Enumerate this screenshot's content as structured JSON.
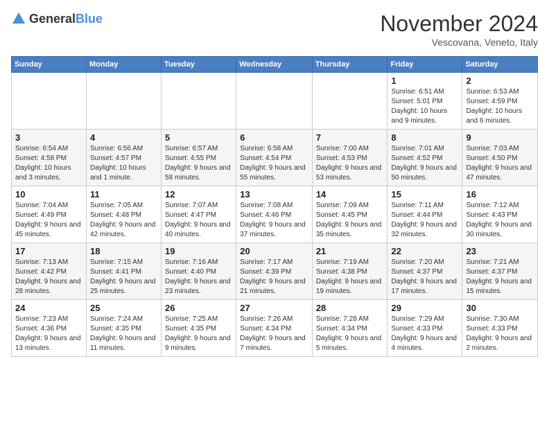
{
  "header": {
    "logo_general": "General",
    "logo_blue": "Blue",
    "title": "November 2024",
    "subtitle": "Vescovana, Veneto, Italy"
  },
  "columns": [
    "Sunday",
    "Monday",
    "Tuesday",
    "Wednesday",
    "Thursday",
    "Friday",
    "Saturday"
  ],
  "weeks": [
    [
      {
        "day": "",
        "info": ""
      },
      {
        "day": "",
        "info": ""
      },
      {
        "day": "",
        "info": ""
      },
      {
        "day": "",
        "info": ""
      },
      {
        "day": "",
        "info": ""
      },
      {
        "day": "1",
        "info": "Sunrise: 6:51 AM\nSunset: 5:01 PM\nDaylight: 10 hours and 9 minutes."
      },
      {
        "day": "2",
        "info": "Sunrise: 6:53 AM\nSunset: 4:59 PM\nDaylight: 10 hours and 6 minutes."
      }
    ],
    [
      {
        "day": "3",
        "info": "Sunrise: 6:54 AM\nSunset: 4:58 PM\nDaylight: 10 hours and 3 minutes."
      },
      {
        "day": "4",
        "info": "Sunrise: 6:56 AM\nSunset: 4:57 PM\nDaylight: 10 hours and 1 minute."
      },
      {
        "day": "5",
        "info": "Sunrise: 6:57 AM\nSunset: 4:55 PM\nDaylight: 9 hours and 58 minutes."
      },
      {
        "day": "6",
        "info": "Sunrise: 6:58 AM\nSunset: 4:54 PM\nDaylight: 9 hours and 55 minutes."
      },
      {
        "day": "7",
        "info": "Sunrise: 7:00 AM\nSunset: 4:53 PM\nDaylight: 9 hours and 53 minutes."
      },
      {
        "day": "8",
        "info": "Sunrise: 7:01 AM\nSunset: 4:52 PM\nDaylight: 9 hours and 50 minutes."
      },
      {
        "day": "9",
        "info": "Sunrise: 7:03 AM\nSunset: 4:50 PM\nDaylight: 9 hours and 47 minutes."
      }
    ],
    [
      {
        "day": "10",
        "info": "Sunrise: 7:04 AM\nSunset: 4:49 PM\nDaylight: 9 hours and 45 minutes."
      },
      {
        "day": "11",
        "info": "Sunrise: 7:05 AM\nSunset: 4:48 PM\nDaylight: 9 hours and 42 minutes."
      },
      {
        "day": "12",
        "info": "Sunrise: 7:07 AM\nSunset: 4:47 PM\nDaylight: 9 hours and 40 minutes."
      },
      {
        "day": "13",
        "info": "Sunrise: 7:08 AM\nSunset: 4:46 PM\nDaylight: 9 hours and 37 minutes."
      },
      {
        "day": "14",
        "info": "Sunrise: 7:09 AM\nSunset: 4:45 PM\nDaylight: 9 hours and 35 minutes."
      },
      {
        "day": "15",
        "info": "Sunrise: 7:11 AM\nSunset: 4:44 PM\nDaylight: 9 hours and 32 minutes."
      },
      {
        "day": "16",
        "info": "Sunrise: 7:12 AM\nSunset: 4:43 PM\nDaylight: 9 hours and 30 minutes."
      }
    ],
    [
      {
        "day": "17",
        "info": "Sunrise: 7:13 AM\nSunset: 4:42 PM\nDaylight: 9 hours and 28 minutes."
      },
      {
        "day": "18",
        "info": "Sunrise: 7:15 AM\nSunset: 4:41 PM\nDaylight: 9 hours and 25 minutes."
      },
      {
        "day": "19",
        "info": "Sunrise: 7:16 AM\nSunset: 4:40 PM\nDaylight: 9 hours and 23 minutes."
      },
      {
        "day": "20",
        "info": "Sunrise: 7:17 AM\nSunset: 4:39 PM\nDaylight: 9 hours and 21 minutes."
      },
      {
        "day": "21",
        "info": "Sunrise: 7:19 AM\nSunset: 4:38 PM\nDaylight: 9 hours and 19 minutes."
      },
      {
        "day": "22",
        "info": "Sunrise: 7:20 AM\nSunset: 4:37 PM\nDaylight: 9 hours and 17 minutes."
      },
      {
        "day": "23",
        "info": "Sunrise: 7:21 AM\nSunset: 4:37 PM\nDaylight: 9 hours and 15 minutes."
      }
    ],
    [
      {
        "day": "24",
        "info": "Sunrise: 7:23 AM\nSunset: 4:36 PM\nDaylight: 9 hours and 13 minutes."
      },
      {
        "day": "25",
        "info": "Sunrise: 7:24 AM\nSunset: 4:35 PM\nDaylight: 9 hours and 11 minutes."
      },
      {
        "day": "26",
        "info": "Sunrise: 7:25 AM\nSunset: 4:35 PM\nDaylight: 9 hours and 9 minutes."
      },
      {
        "day": "27",
        "info": "Sunrise: 7:26 AM\nSunset: 4:34 PM\nDaylight: 9 hours and 7 minutes."
      },
      {
        "day": "28",
        "info": "Sunrise: 7:28 AM\nSunset: 4:34 PM\nDaylight: 9 hours and 5 minutes."
      },
      {
        "day": "29",
        "info": "Sunrise: 7:29 AM\nSunset: 4:33 PM\nDaylight: 9 hours and 4 minutes."
      },
      {
        "day": "30",
        "info": "Sunrise: 7:30 AM\nSunset: 4:33 PM\nDaylight: 9 hours and 2 minutes."
      }
    ]
  ]
}
